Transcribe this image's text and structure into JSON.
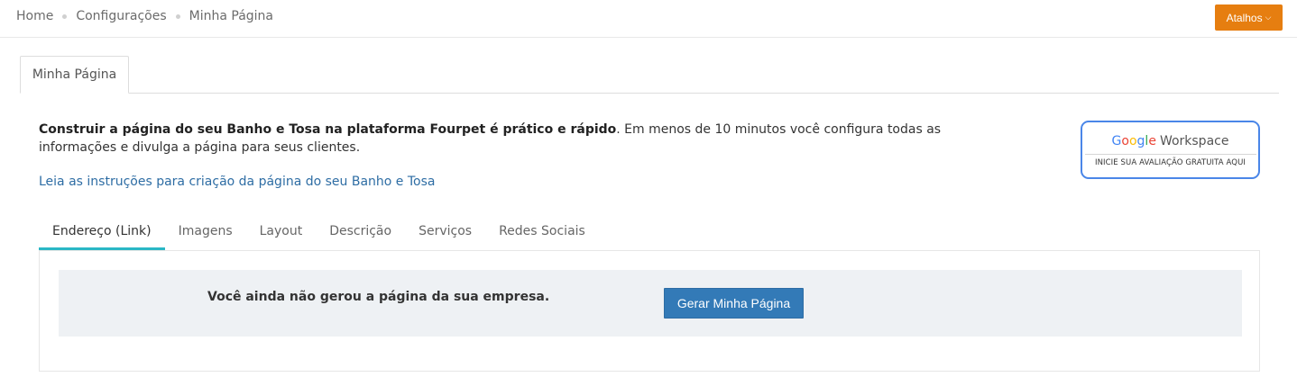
{
  "breadcrumb": {
    "items": [
      "Home",
      "Configurações",
      "Minha Página"
    ]
  },
  "header": {
    "shortcuts_label": "Atalhos",
    "shortcuts_icon": "chevron-down-icon",
    "accent_color": "#e67e10"
  },
  "page_tabs": [
    {
      "label": "Minha Página",
      "active": true
    }
  ],
  "intro": {
    "bold_text": "Construir a página do seu Banho e Tosa na plataforma Fourpet é prático e rápido",
    "rest_text": ". Em menos de 10 minutos você configura todas as informações e divulga a página para seus clientes.",
    "link_text": "Leia as instruções para criação da página do seu Banho e Tosa"
  },
  "google_workspace": {
    "brand": "Google",
    "product": "Workspace",
    "cta": "INICIE SUA AVALIAÇÃO GRATUITA AQUI"
  },
  "sub_tabs": [
    {
      "label": "Endereço (Link)",
      "active": true
    },
    {
      "label": "Imagens",
      "active": false
    },
    {
      "label": "Layout",
      "active": false
    },
    {
      "label": "Descrição",
      "active": false
    },
    {
      "label": "Serviços",
      "active": false
    },
    {
      "label": "Redes Sociais",
      "active": false
    }
  ],
  "panel": {
    "notice_text": "Você ainda não gerou a página da sua empresa.",
    "generate_button": "Gerar Minha Página",
    "active_tab_color": "#2ab7c5"
  }
}
